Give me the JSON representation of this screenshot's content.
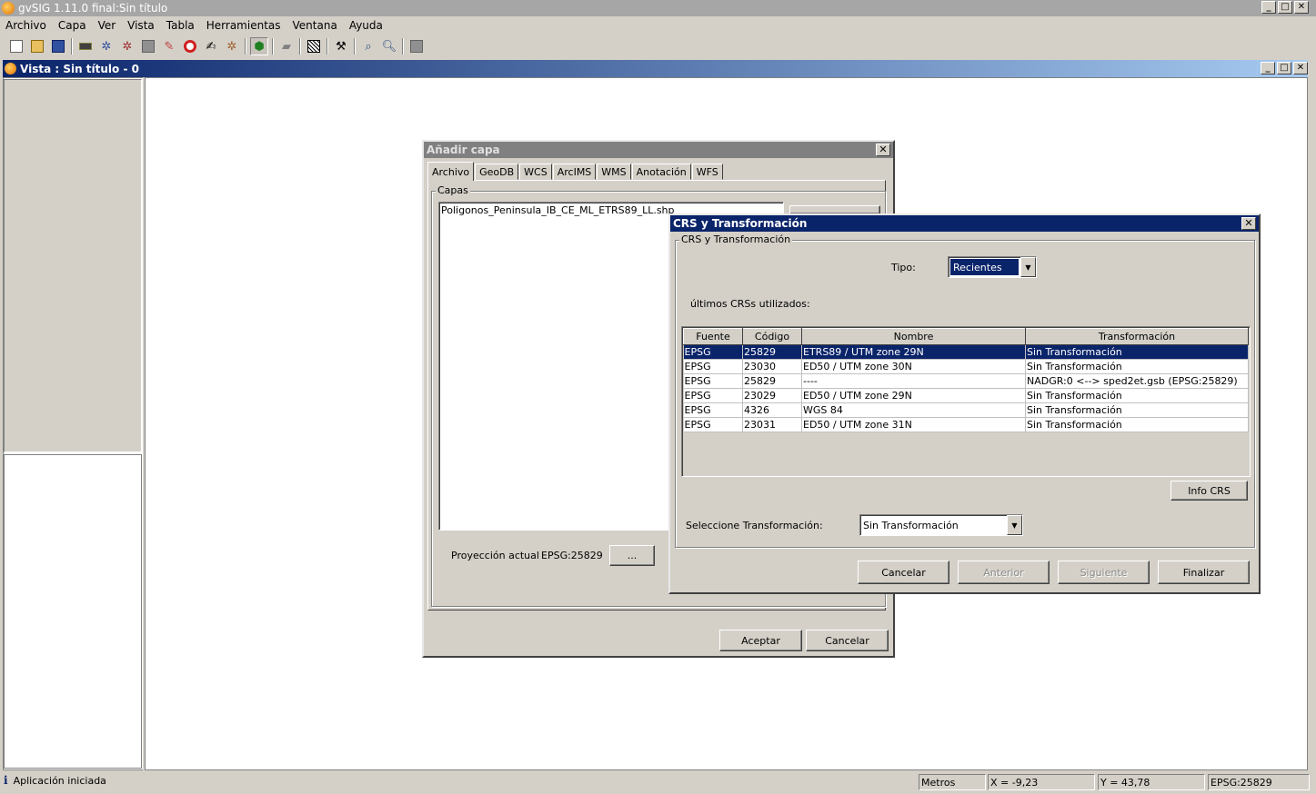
{
  "app": {
    "title": "gvSIG 1.11.0 final:Sin título"
  },
  "menu": [
    "Archivo",
    "Capa",
    "Ver",
    "Vista",
    "Tabla",
    "Herramientas",
    "Ventana",
    "Ayuda"
  ],
  "window_controls": {
    "minimize": "_",
    "maximize": "□",
    "close": "✕"
  },
  "vista": {
    "title": "Vista : Sin título - 0"
  },
  "add_layer": {
    "title": "Añadir capa",
    "tabs": [
      "Archivo",
      "GeoDB",
      "WCS",
      "ArcIMS",
      "WMS",
      "Anotación",
      "WFS"
    ],
    "group_label": "Capas",
    "layers": [
      "Poligonos_Peninsula_IB_CE_ML_ETRS89_LL.shp"
    ],
    "projection_label": "Proyección actual",
    "projection_value": "EPSG:25829",
    "projection_button": "...",
    "accept": "Aceptar",
    "cancel": "Cancelar",
    "close": "✕"
  },
  "crs_dialog": {
    "title": "CRS y Transformación",
    "group_label": "CRS y Transformación",
    "tipo_label": "Tipo:",
    "tipo_value": "Recientes",
    "recent_label": "últimos CRSs utilizados:",
    "columns": [
      "Fuente",
      "Código",
      "Nombre",
      "Transformación"
    ],
    "rows": [
      [
        "EPSG",
        "25829",
        "ETRS89 / UTM zone 29N",
        "Sin Transformación"
      ],
      [
        "EPSG",
        "23030",
        "ED50 / UTM zone 30N",
        "Sin Transformación"
      ],
      [
        "EPSG",
        "25829",
        "----",
        "NADGR:0 <--> sped2et.gsb (EPSG:25829)"
      ],
      [
        "EPSG",
        "23029",
        "ED50 / UTM zone 29N",
        "Sin Transformación"
      ],
      [
        "EPSG",
        "4326",
        "WGS 84",
        "Sin Transformación"
      ],
      [
        "EPSG",
        "23031",
        "ED50 / UTM zone 31N",
        "Sin Transformación"
      ]
    ],
    "selected_row": 0,
    "info_button": "Info CRS",
    "transform_label": "Seleccione Transformación:",
    "transform_value": "Sin Transformación",
    "buttons": {
      "cancel": "Cancelar",
      "previous": "Anterior",
      "next": "Siguiente",
      "finish": "Finalizar"
    },
    "close": "✕"
  },
  "status": {
    "message": "Aplicación iniciada",
    "units": "Metros",
    "x": "X = -9,23",
    "y": "Y = 43,78",
    "crs": "EPSG:25829"
  },
  "colors": {
    "selection": "#0a246a",
    "titlebar_active": "#0a246a",
    "panel": "#d4d0c8"
  }
}
